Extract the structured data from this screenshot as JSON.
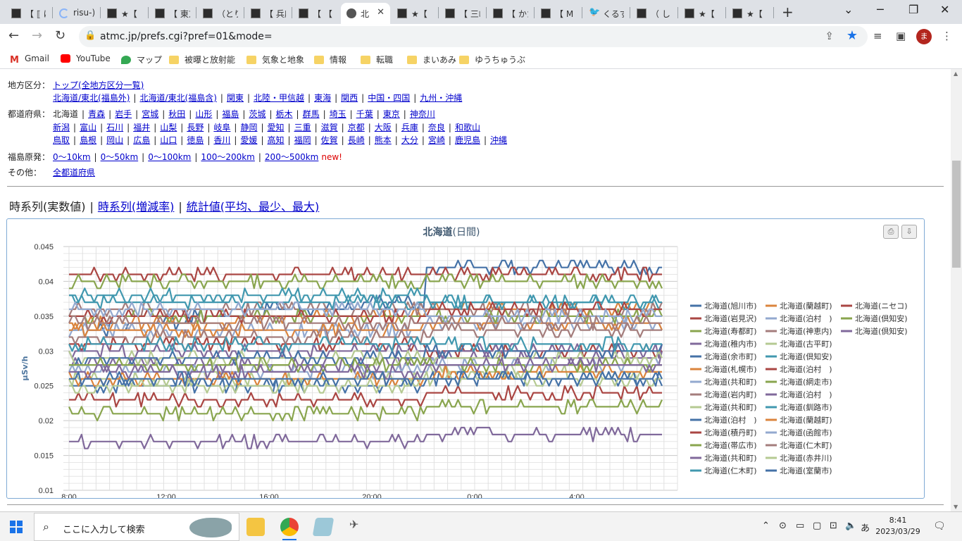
{
  "browser": {
    "tabs": [
      {
        "label": "【 ⟦ は",
        "icon": "window-icon"
      },
      {
        "label": "risu-)",
        "icon": "loading-icon"
      },
      {
        "label": "★【",
        "icon": "window-icon"
      },
      {
        "label": "【 東京",
        "icon": "window-icon"
      },
      {
        "label": "（とり",
        "icon": "window-icon"
      },
      {
        "label": "【 兵庫",
        "icon": "window-icon"
      },
      {
        "label": "【 【 裏",
        "icon": "window-icon"
      },
      {
        "label": "北",
        "icon": "globe-icon",
        "active": true
      },
      {
        "label": "★【",
        "icon": "window-icon"
      },
      {
        "label": "【 三峰",
        "icon": "window-icon"
      },
      {
        "label": "【 かた",
        "icon": "window-icon"
      },
      {
        "label": "【 M",
        "icon": "window-icon"
      },
      {
        "label": "くるす",
        "icon": "twitter-icon"
      },
      {
        "label": "（ し",
        "icon": "window-icon"
      },
      {
        "label": "★【",
        "icon": "window-icon"
      },
      {
        "label": "★【",
        "icon": "window-icon"
      }
    ],
    "close_tab": "✕",
    "new_tab": "+",
    "url": "atmc.jp/prefs.cgi?pref=01&mode=",
    "avatar": "ま",
    "bookmarks": [
      "Gmail",
      "YouTube",
      "マップ",
      "被曝と放射能",
      "気象と地象",
      "情報",
      "転職",
      "まいあみ",
      "ゆうちゅうぶ"
    ]
  },
  "nav": {
    "region_label": "地方区分：",
    "region_links_1": [
      "トップ(全地方区分一覧)"
    ],
    "region_links_2": [
      "北海道/東北(福島外)",
      "北海道/東北(福島含)",
      "関東",
      "北陸・甲信越",
      "東海",
      "関西",
      "中国・四国",
      "九州・沖縄"
    ],
    "pref_label": "都道府県：",
    "pref_current": "北海道",
    "pref_row1": [
      "青森",
      "岩手",
      "宮城",
      "秋田",
      "山形",
      "福島",
      "茨城",
      "栃木",
      "群馬",
      "埼玉",
      "千葉",
      "東京",
      "神奈川"
    ],
    "pref_row2": [
      "新潟",
      "富山",
      "石川",
      "福井",
      "山梨",
      "長野",
      "岐阜",
      "静岡",
      "愛知",
      "三重",
      "滋賀",
      "京都",
      "大阪",
      "兵庫",
      "奈良",
      "和歌山"
    ],
    "pref_row3": [
      "鳥取",
      "島根",
      "岡山",
      "広島",
      "山口",
      "徳島",
      "香川",
      "愛媛",
      "高知",
      "福岡",
      "佐賀",
      "長崎",
      "熊本",
      "大分",
      "宮崎",
      "鹿児島",
      "沖縄"
    ],
    "fuku_label": "福島原発：",
    "fuku_links": [
      "0～10km",
      "0～50km",
      "0～100km",
      "100～200km",
      "200～500km"
    ],
    "fuku_new": "new!",
    "other_label": "その他：",
    "other_links": [
      "全都道府県"
    ]
  },
  "modes": {
    "current": "時系列(実数値)",
    "link1": "時系列(増減率)",
    "link2": "統計値(平均、最少、最大)"
  },
  "chart_data": {
    "type": "line",
    "title": "北海道",
    "subtitle": "(日間)",
    "ylabel": "µSv/h",
    "ylim": [
      0.01,
      0.045
    ],
    "yticks": [
      "0.045",
      "0.04",
      "0.035",
      "0.03",
      "0.025",
      "0.02",
      "0.015",
      "0.01"
    ],
    "xticks": [
      "8:00",
      "12:00",
      "16:00",
      "20:00",
      "0:00",
      "4:00"
    ],
    "grid": true,
    "legend_position": "right",
    "series": [
      {
        "name": "北海道(旭川市)",
        "color": "#4572a7",
        "start": 0.033,
        "end": 0.042
      },
      {
        "name": "北海道(蘭越町)",
        "color": "#db843d",
        "start": 0.034,
        "end": 0.036
      },
      {
        "name": "北海道(ニセコ)",
        "color": "#aa4643",
        "start": 0.041,
        "end": 0.041
      },
      {
        "name": "北海道(岩見沢)",
        "color": "#aa4643",
        "start": 0.023,
        "end": 0.024
      },
      {
        "name": "北海道(泊村　)",
        "color": "#93a9cf",
        "start": 0.033,
        "end": 0.034
      },
      {
        "name": "北海道(倶知安)",
        "color": "#89a54e",
        "start": 0.04,
        "end": 0.04
      },
      {
        "name": "北海道(寿都町)",
        "color": "#89a54e",
        "start": 0.021,
        "end": 0.022
      },
      {
        "name": "北海道(神恵内)",
        "color": "#a47d7c",
        "start": 0.036,
        "end": 0.036
      },
      {
        "name": "北海道(倶知安)",
        "color": "#80699b",
        "start": 0.017,
        "end": 0.018
      },
      {
        "name": "北海道(稚内市)",
        "color": "#80699b",
        "start": 0.028,
        "end": 0.029
      },
      {
        "name": "北海道(古平町)",
        "color": "#b5ca92",
        "start": 0.026,
        "end": 0.027
      },
      {
        "name": "北海道(余市町)",
        "color": "#4572a7",
        "start": 0.025,
        "end": 0.026
      },
      {
        "name": "北海道(倶知安)",
        "color": "#4198af",
        "start": 0.038,
        "end": 0.037
      },
      {
        "name": "北海道(札幌市)",
        "color": "#db843d",
        "start": 0.033,
        "end": 0.034
      },
      {
        "name": "北海道(泊村　)",
        "color": "#aa4643",
        "start": 0.031,
        "end": 0.03
      },
      {
        "name": "北海道(共和町)",
        "color": "#93a9cf",
        "start": 0.027,
        "end": 0.028
      },
      {
        "name": "北海道(網走市)",
        "color": "#89a54e",
        "start": 0.035,
        "end": 0.035
      },
      {
        "name": "北海道(岩内町)",
        "color": "#a47d7c",
        "start": 0.032,
        "end": 0.033
      },
      {
        "name": "北海道(泊村　)",
        "color": "#80699b",
        "start": 0.03,
        "end": 0.03
      },
      {
        "name": "北海道(共和町)",
        "color": "#b5ca92",
        "start": 0.029,
        "end": 0.029
      },
      {
        "name": "北海道(釧路市)",
        "color": "#4198af",
        "start": 0.037,
        "end": 0.037
      },
      {
        "name": "北海道(泊村　)",
        "color": "#4572a7",
        "start": 0.029,
        "end": 0.03
      },
      {
        "name": "北海道(蘭越町)",
        "color": "#db843d",
        "start": 0.026,
        "end": 0.027
      },
      {
        "name": "北海道(積丹町)",
        "color": "#aa4643",
        "start": 0.035,
        "end": 0.036
      },
      {
        "name": "北海道(函館市)",
        "color": "#93a9cf",
        "start": 0.036,
        "end": 0.035
      },
      {
        "name": "北海道(帯広市)",
        "color": "#89a54e",
        "start": 0.028,
        "end": 0.028
      },
      {
        "name": "北海道(仁木町)",
        "color": "#a47d7c",
        "start": 0.034,
        "end": 0.034
      },
      {
        "name": "北海道(共和町)",
        "color": "#80699b",
        "start": 0.027,
        "end": 0.028
      },
      {
        "name": "北海道(赤井川)",
        "color": "#b5ca92",
        "start": 0.025,
        "end": 0.026
      },
      {
        "name": "北海道(仁木町)",
        "color": "#4198af",
        "start": 0.031,
        "end": 0.031
      },
      {
        "name": "北海道(室蘭市)",
        "color": "#4572a7",
        "start": 0.026,
        "end": 0.026
      }
    ]
  },
  "taskbar": {
    "search_placeholder": "ここに入力して検索",
    "time": "8:41",
    "date": "2023/03/29",
    "ime": "あ"
  }
}
